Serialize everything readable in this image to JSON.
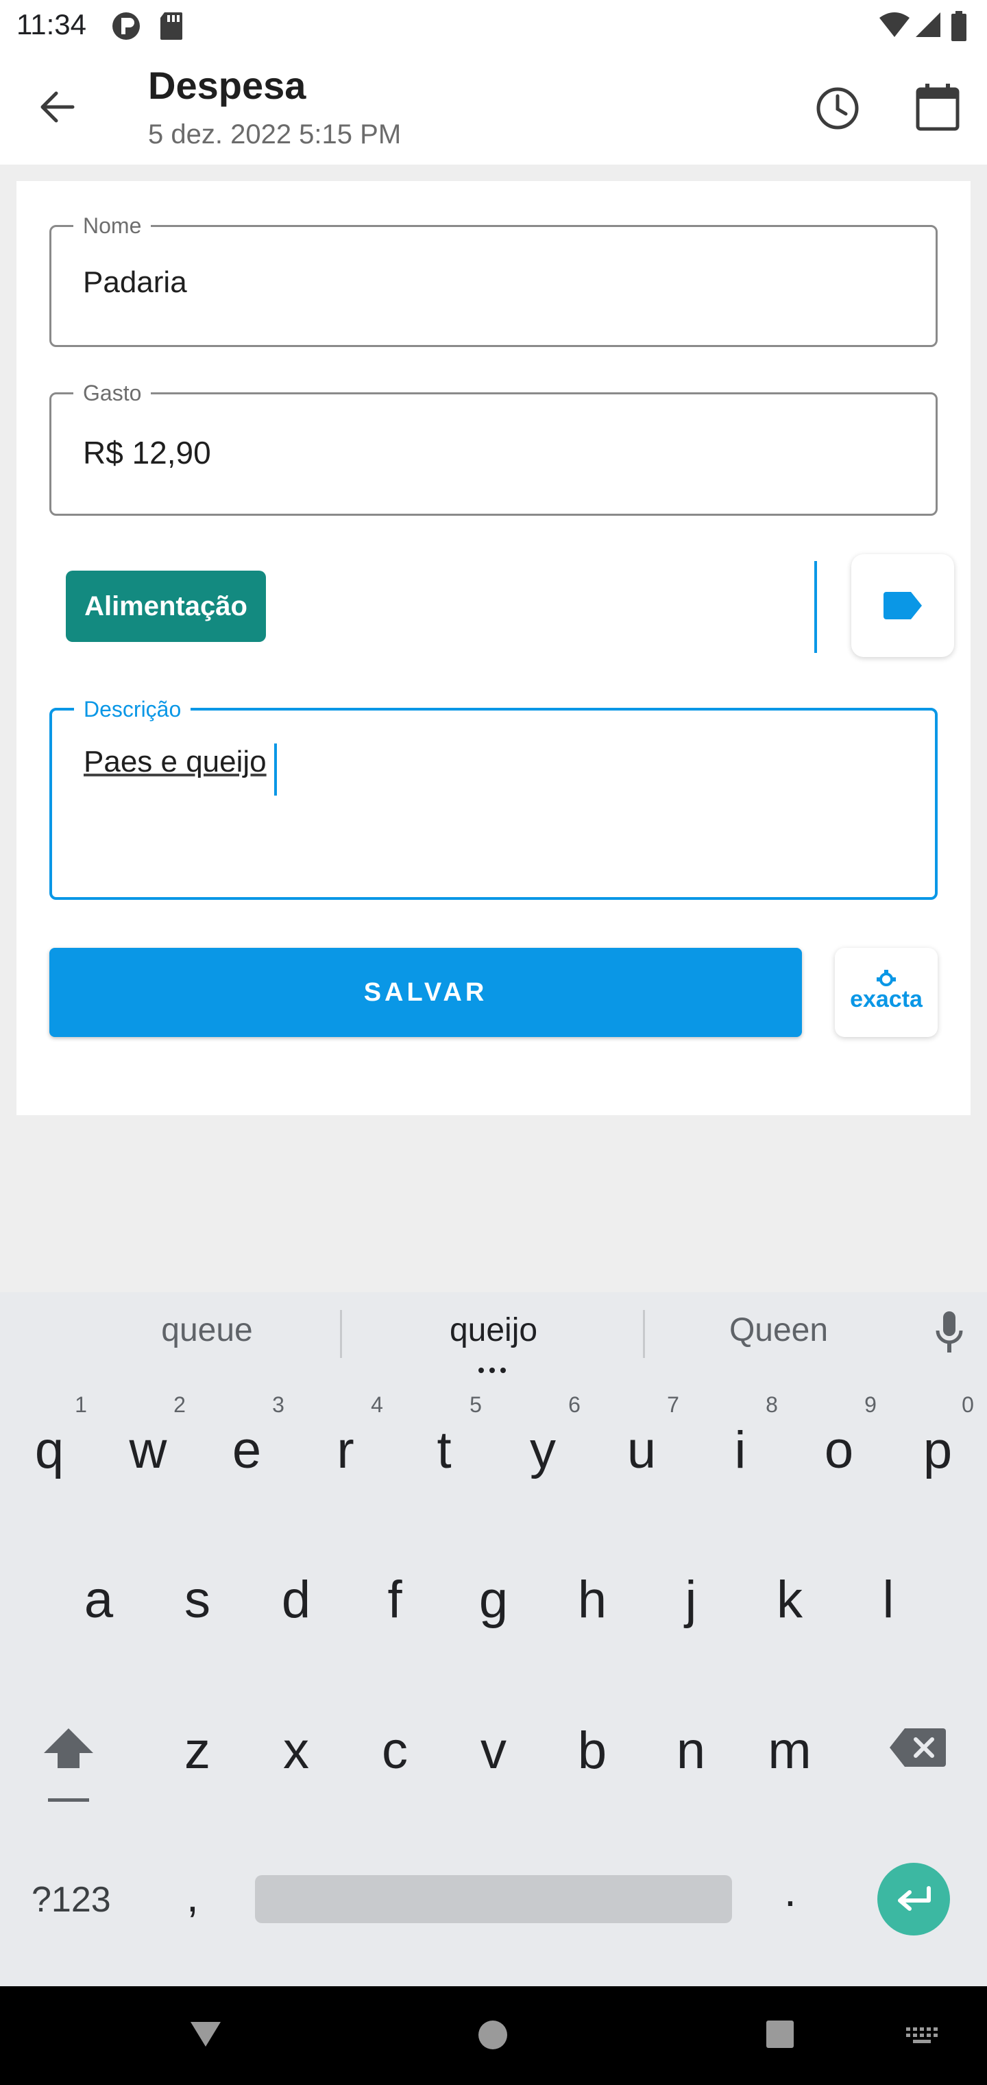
{
  "status_bar": {
    "time": "11:34"
  },
  "app_bar": {
    "title": "Despesa",
    "subtitle": "5 dez. 2022 5:15 PM",
    "icons": [
      "arrow-back-icon",
      "clock-icon",
      "calendar-icon"
    ]
  },
  "form": {
    "name_label": "Nome",
    "name_value": "Padaria",
    "amount_label": "Gasto",
    "amount_value": "R$ 12,90",
    "category": "Alimentação",
    "description_label": "Descrição",
    "description_value": "Paes e queijo",
    "save_label": "SALVAR",
    "exacta_logo_text": "exacta"
  },
  "colors": {
    "accent": "#0a97e6",
    "chip": "#138a80",
    "enter_key": "#3cb8a2"
  },
  "keyboard": {
    "suggestions": [
      "queue",
      "queijo",
      "Queen"
    ],
    "row1": [
      "q",
      "w",
      "e",
      "r",
      "t",
      "y",
      "u",
      "i",
      "o",
      "p"
    ],
    "row1_hints": [
      "1",
      "2",
      "3",
      "4",
      "5",
      "6",
      "7",
      "8",
      "9",
      "0"
    ],
    "row2": [
      "a",
      "s",
      "d",
      "f",
      "g",
      "h",
      "j",
      "k",
      "l"
    ],
    "row3": [
      "z",
      "x",
      "c",
      "v",
      "b",
      "n",
      "m"
    ],
    "symbols_label": "?123",
    "comma": ",",
    "period": "."
  }
}
